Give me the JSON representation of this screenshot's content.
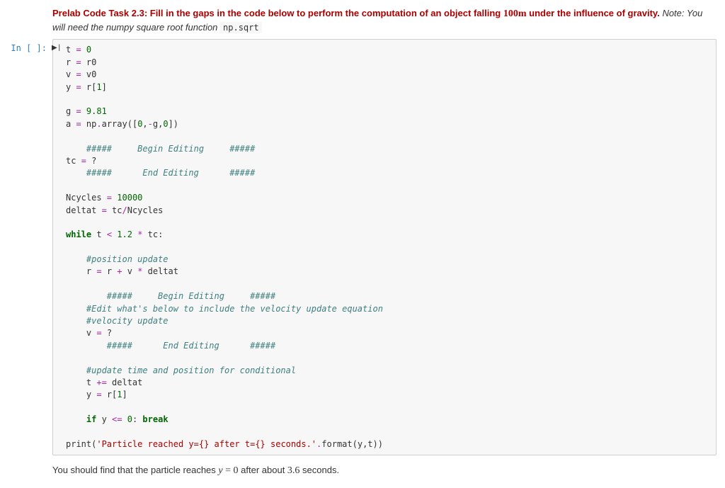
{
  "task": {
    "title_prefix": "Prelab Code Task 2.3: Fill in the gaps in the code below to perform the computation of an object falling ",
    "title_math": "100m",
    "title_suffix": " under the influence of gravity.",
    "note_label": " Note: ",
    "note_text": "You will need the numpy square root function ",
    "note_code": "np.sqrt"
  },
  "prompt": {
    "label": "In [ ]:"
  },
  "run_glyph": "▶|",
  "code": {
    "l01_a": "t ",
    "l01_op": "=",
    "l01_b": " ",
    "l01_n": "0",
    "l02_a": "r ",
    "l02_op": "=",
    "l02_b": " r0",
    "l03_a": "v ",
    "l03_op": "=",
    "l03_b": " v0",
    "l04_a": "y ",
    "l04_op": "=",
    "l04_b": " r[",
    "l04_n": "1",
    "l04_c": "]",
    "l06_a": "g ",
    "l06_op": "=",
    "l06_b": " ",
    "l06_n": "9.81",
    "l07_a": "a ",
    "l07_op": "=",
    "l07_b": " np",
    "l07_dot": ".",
    "l07_c": "array([",
    "l07_n0": "0",
    "l07_cm1": ",",
    "l07_neg": "-",
    "l07_g": "g,",
    "l07_n2": "0",
    "l07_d": "])",
    "l09_c": "    #####     Begin Editing     #####",
    "l10_a": "tc ",
    "l10_op": "=",
    "l10_b": " ",
    "l10_q": "?",
    "l11_c": "    #####      End Editing      #####",
    "l13_a": "Ncycles ",
    "l13_op": "=",
    "l13_b": " ",
    "l13_n": "10000",
    "l14_a": "deltat ",
    "l14_op": "=",
    "l14_b": " tc",
    "l14_div": "/",
    "l14_c": "Ncycles",
    "l16_kw": "while",
    "l16_a": " t ",
    "l16_lt": "<",
    "l16_b": " ",
    "l16_n": "1.2",
    "l16_c": " ",
    "l16_mul": "*",
    "l16_d": " tc:",
    "l18_c": "    #position update",
    "l19_a": "    r ",
    "l19_op": "=",
    "l19_b": " r ",
    "l19_plus": "+",
    "l19_c": " v ",
    "l19_mul": "*",
    "l19_d": " deltat",
    "l21_c": "        #####     Begin Editing     #####",
    "l22_c": "    #Edit what's below to include the velocity update equation",
    "l23_c": "    #velocity update",
    "l24_a": "    v ",
    "l24_op": "=",
    "l24_b": " ",
    "l24_q": "?",
    "l25_c": "        #####      End Editing      #####",
    "l27_c": "    #update time and position for conditional",
    "l28_a": "    t ",
    "l28_op": "+=",
    "l28_b": " deltat",
    "l29_a": "    y ",
    "l29_op": "=",
    "l29_b": " r[",
    "l29_n": "1",
    "l29_c": "]",
    "l31_ind": "    ",
    "l31_if": "if",
    "l31_a": " y ",
    "l31_le": "<=",
    "l31_b": " ",
    "l31_n": "0",
    "l31_c": ": ",
    "l31_br": "break",
    "l33_a": "print(",
    "l33_s": "'Particle reached y={} after t={} seconds.'",
    "l33_dot": ".",
    "l33_b": "format(y,t))"
  },
  "followup": {
    "pre": "You should find that the particle reaches ",
    "math1": "y = 0",
    "mid": " after about ",
    "math2": "3.6",
    "post": " seconds."
  }
}
